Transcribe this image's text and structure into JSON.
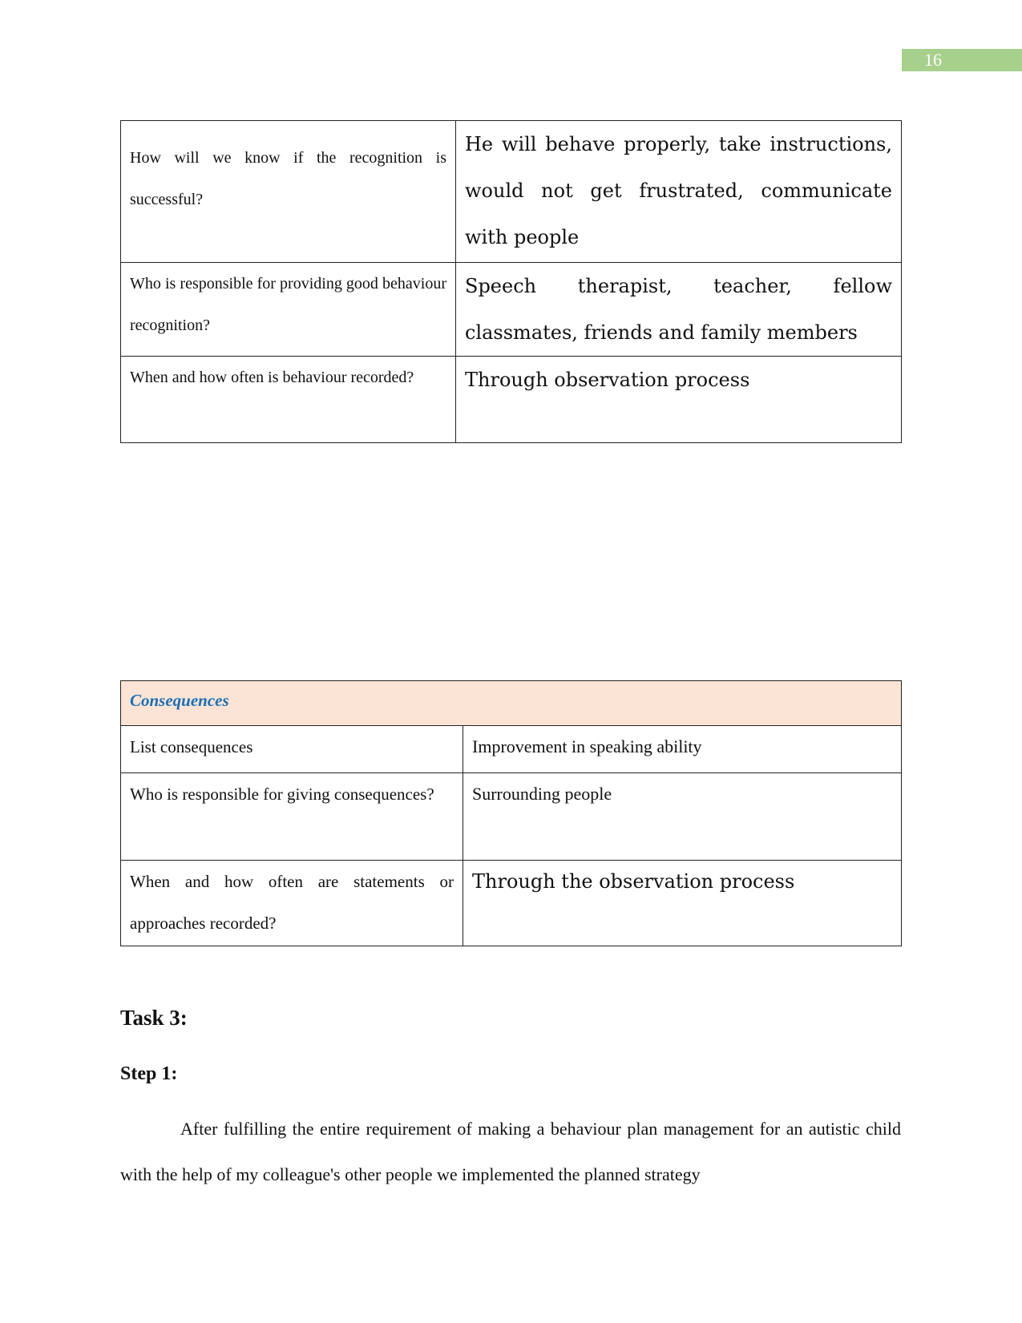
{
  "page_number": "16",
  "recognition_table": {
    "rows": [
      {
        "question": "How will we know if the recognition is successful?",
        "answer": "He will behave properly, take instructions, would not get frustrated, communicate with people"
      },
      {
        "question": "Who is responsible for providing good behaviour recognition?",
        "answer": "Speech therapist, teacher, fellow classmates, friends and family members"
      },
      {
        "question": "When and how often is behaviour recorded?",
        "answer": "Through observation process"
      }
    ]
  },
  "consequences_table": {
    "header": "Consequences",
    "header_color": "#1a6fb5",
    "header_bg": "#fbe4d5",
    "rows": [
      {
        "question": "List consequences",
        "answer": "Improvement in speaking ability"
      },
      {
        "question": "Who is responsible for giving consequences?",
        "answer": "Surrounding people"
      },
      {
        "question": "When and how often are statements or approaches recorded?",
        "answer": "Through the observation process"
      }
    ]
  },
  "task_heading": "Task 3:",
  "step_heading": "Step 1:",
  "paragraph": "After fulfilling the entire requirement of making a behaviour plan management for an autistic child with the help of my colleague's other people we implemented the planned strategy"
}
